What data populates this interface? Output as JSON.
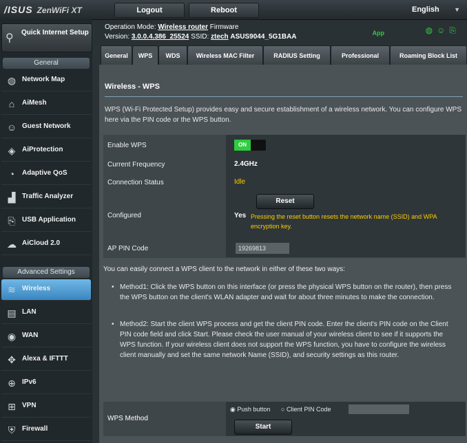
{
  "header": {
    "brand": "/ISUS",
    "model": "ZenWiFi XT",
    "logout_label": "Logout",
    "reboot_label": "Reboot",
    "language": "English"
  },
  "sidebar": {
    "quick_setup": "Quick Internet Setup",
    "general_header": "General",
    "general_items": [
      {
        "label": "Network Map",
        "icon": "globe-icon"
      },
      {
        "label": "AiMesh",
        "icon": "mesh-icon"
      },
      {
        "label": "Guest Network",
        "icon": "guest-icon"
      },
      {
        "label": "AiProtection",
        "icon": "shield-icon"
      },
      {
        "label": "Adaptive QoS",
        "icon": "gauge-icon"
      },
      {
        "label": "Traffic Analyzer",
        "icon": "chart-icon"
      },
      {
        "label": "USB Application",
        "icon": "usb-icon"
      },
      {
        "label": "AiCloud 2.0",
        "icon": "cloud-icon"
      }
    ],
    "advanced_header": "Advanced Settings",
    "advanced_items": [
      {
        "label": "Wireless",
        "icon": "wifi-icon"
      },
      {
        "label": "LAN",
        "icon": "lan-icon"
      },
      {
        "label": "WAN",
        "icon": "wan-icon"
      },
      {
        "label": "Alexa & IFTTT",
        "icon": "alexa-icon"
      },
      {
        "label": "IPv6",
        "icon": "ipv6-icon"
      },
      {
        "label": "VPN",
        "icon": "vpn-icon"
      },
      {
        "label": "Firewall",
        "icon": "firewall-icon"
      }
    ]
  },
  "status": {
    "op_mode_label": "Operation Mode:",
    "op_mode_value": "Wireless router",
    "firmware_label": "Firmware",
    "version_label": "Version:",
    "version_value": "3.0.0.4.386_25524",
    "ssid_label": "SSID:",
    "ssid_value": "ztech",
    "ssid_value2": "ASUS9044_5G1BAA",
    "app_label": "App"
  },
  "tabs": [
    "General",
    "WPS",
    "WDS",
    "Wireless MAC Filter",
    "RADIUS Setting",
    "Professional",
    "Roaming Block List"
  ],
  "active_tab": "WPS",
  "content": {
    "title": "Wireless - WPS",
    "description": "WPS (Wi-Fi Protected Setup) provides easy and secure establishment of a wireless network. You can configure WPS here via the PIN code or the WPS button.",
    "rows": {
      "enable_wps_label": "Enable WPS",
      "toggle_state": "ON",
      "current_freq_label": "Current Frequency",
      "current_freq_value": "2.4GHz",
      "connection_status_label": "Connection Status",
      "connection_status_value": "Idle",
      "configured_label": "Configured",
      "reset_label": "Reset",
      "configured_value": "Yes",
      "configured_note": "Pressing the reset button resets the network name (SSID) and WPA encryption key.",
      "ap_pin_label": "AP PIN Code",
      "ap_pin_value": "19269813"
    },
    "intro": "You can easily connect a WPS client to the network in either of these two ways:",
    "method1": "Method1: Click the WPS button on this interface (or press the physical WPS button on the router), then press the WPS button on the client's WLAN adapter and wait for about three minutes to make the connection.",
    "method2": "Method2: Start the client WPS process and get the client PIN code. Enter the client's PIN code on the Client PIN code field and click Start. Please check the user manual of your wireless client to see if it supports the WPS function. If your wireless client does not support the WPS function, you have to configure the wireless client manually and set the same network Name (SSID), and security settings as this router.",
    "wps_method_label": "WPS Method",
    "radio_push": "Push button",
    "radio_pin": "Client PIN Code",
    "start_label": "Start"
  }
}
